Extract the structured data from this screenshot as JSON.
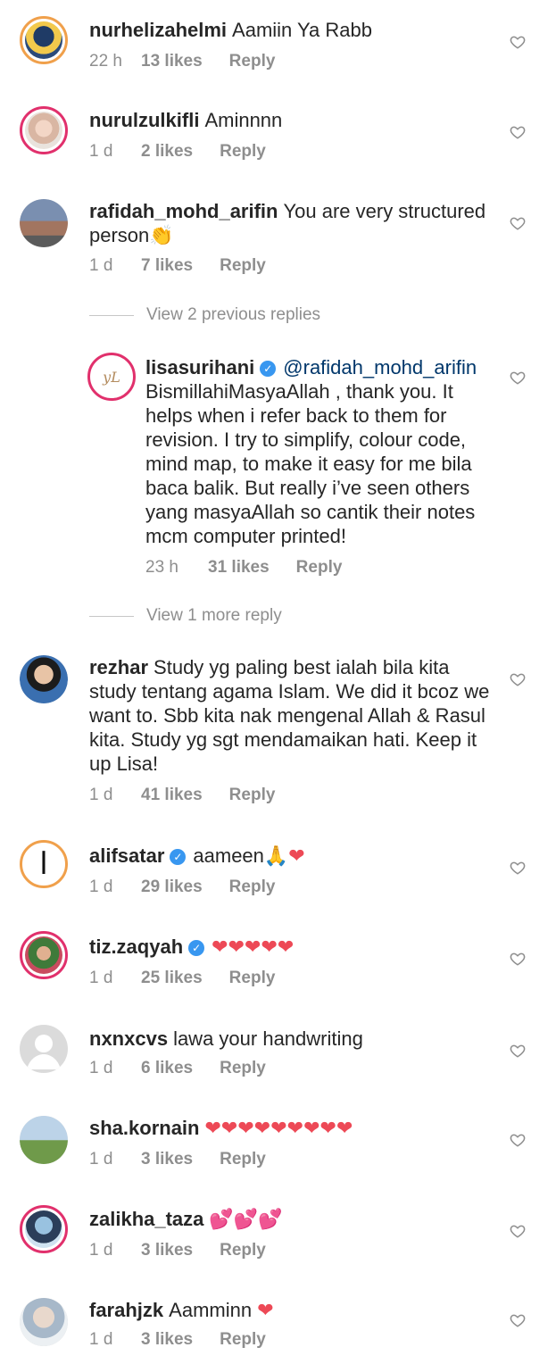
{
  "comments": [
    {
      "user": "nurhelizahelmi",
      "text": "Aamiin Ya Rabb",
      "time": "22 h",
      "likes": "13 likes",
      "reply": "Reply"
    },
    {
      "user": "nurulzulkifli",
      "text": "Aminnnn",
      "time": "1 d",
      "likes": "2 likes",
      "reply": "Reply"
    },
    {
      "user": "rafidah_mohd_arifin",
      "text": "You are very structured person",
      "emoji": "👏",
      "time": "1 d",
      "likes": "7 likes",
      "reply": "Reply"
    },
    {
      "user": "lisasurihani",
      "mention": "@rafidah_mohd_arifin",
      "text": "BismillahiMasyaAllah , thank you. It helps when i refer back to them for revision. I try to simplify, colour code, mind map, to make it easy for me bila baca balik. But really i’ve seen others yang masyaAllah so cantik their notes mcm computer printed!",
      "time": "23 h",
      "likes": "31 likes",
      "reply": "Reply"
    },
    {
      "user": "rezhar",
      "text": "Study yg paling best ialah bila kita study tentang agama Islam. We did it bcoz we want to. Sbb kita nak mengenal Allah & Rasul kita. Study yg sgt mendamaikan hati. Keep it up Lisa!",
      "time": "1 d",
      "likes": "41 likes",
      "reply": "Reply"
    },
    {
      "user": "alifsatar",
      "text": "aameen",
      "emoji": "🙏❤",
      "time": "1 d",
      "likes": "29 likes",
      "reply": "Reply"
    },
    {
      "user": "tiz.zaqyah",
      "text": "",
      "emoji": "❤❤❤❤❤",
      "time": "1 d",
      "likes": "25 likes",
      "reply": "Reply"
    },
    {
      "user": "nxnxcvs",
      "text": "lawa your handwriting",
      "time": "1 d",
      "likes": "6 likes",
      "reply": "Reply"
    },
    {
      "user": "sha.kornain",
      "text": "",
      "emoji": "❤❤❤❤❤❤❤❤❤",
      "time": "1 d",
      "likes": "3 likes",
      "reply": "Reply"
    },
    {
      "user": "zalikha_taza",
      "text": "",
      "emoji": "💕💕💕",
      "time": "1 d",
      "likes": "3 likes",
      "reply": "Reply"
    },
    {
      "user": "farahjzk",
      "text": "Aamminn",
      "emoji": "❤",
      "time": "1 d",
      "likes": "3 likes",
      "reply": "Reply"
    }
  ],
  "view_previous": "View 2 previous replies",
  "view_more": "View 1 more reply",
  "colors": {
    "accent_ring": "#e1306c",
    "verified": "#3897f0",
    "heart_emoji": "#ed4956",
    "muted": "#8e8e8e"
  }
}
